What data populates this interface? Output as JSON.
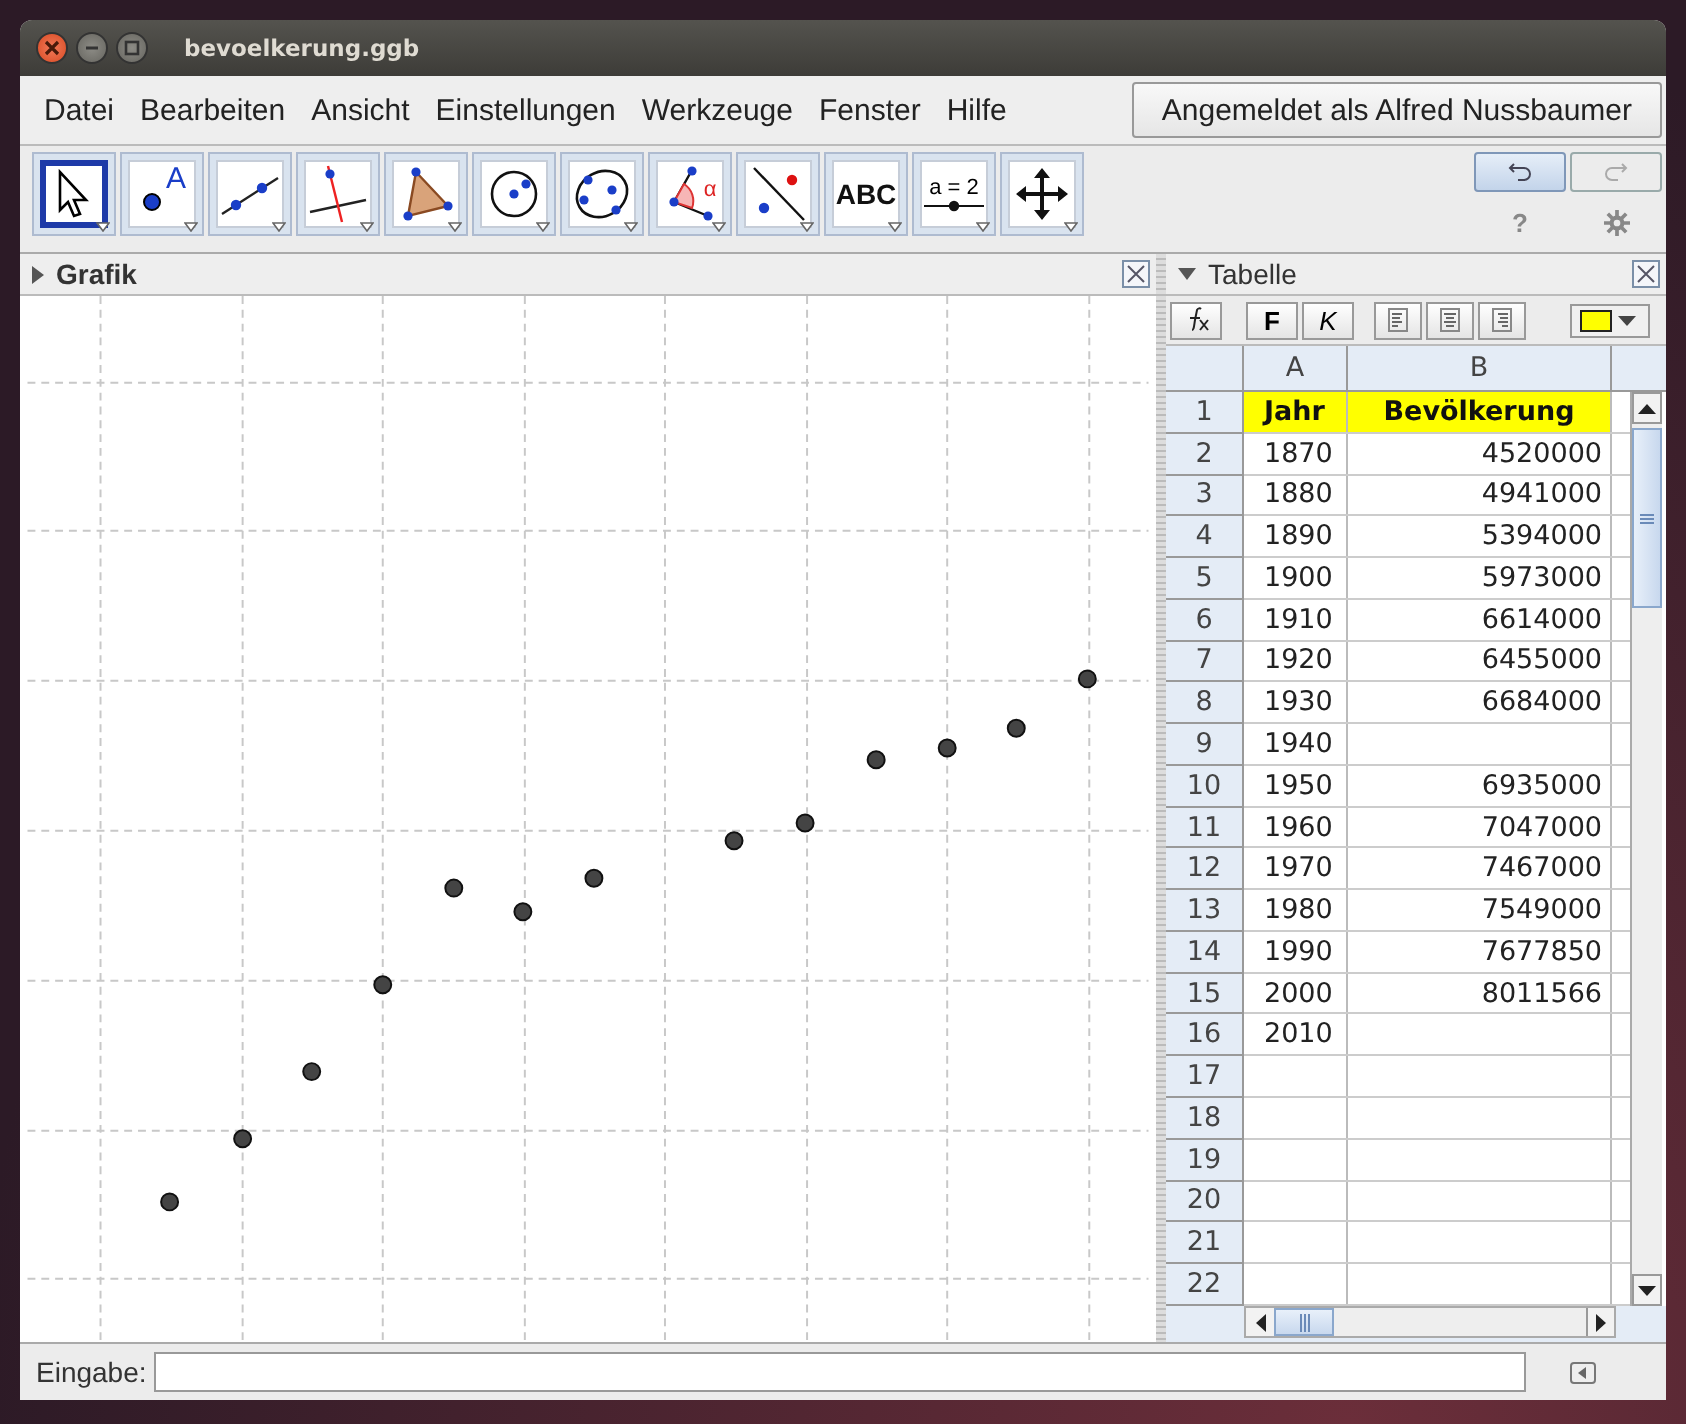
{
  "window": {
    "title": "bevoelkerung.ggb"
  },
  "menu": [
    "Datei",
    "Bearbeiten",
    "Ansicht",
    "Einstellungen",
    "Werkzeuge",
    "Fenster",
    "Hilfe"
  ],
  "login_button": "Angemeldet als Alfred Nussbaumer",
  "tools": [
    {
      "kind": "move",
      "selected": true
    },
    {
      "kind": "point",
      "label": "A",
      "selected": false
    },
    {
      "kind": "line",
      "selected": false
    },
    {
      "kind": "perpendicular",
      "selected": false
    },
    {
      "kind": "polygon",
      "selected": false
    },
    {
      "kind": "circle",
      "selected": false
    },
    {
      "kind": "conic",
      "selected": false
    },
    {
      "kind": "angle",
      "label": "α",
      "selected": false
    },
    {
      "kind": "reflect",
      "selected": false
    },
    {
      "kind": "text",
      "label": "ABC",
      "selected": false
    },
    {
      "kind": "slider",
      "label": "a = 2",
      "selected": false
    },
    {
      "kind": "move-view",
      "selected": false
    }
  ],
  "help": "?",
  "graphics": {
    "title": "Grafik"
  },
  "spreadsheet": {
    "title": "Tabelle",
    "toolbar": {
      "bold": "F",
      "italic": "K"
    },
    "columns": [
      "A",
      "B"
    ],
    "rows": [
      {
        "number": "1",
        "a": "Jahr",
        "b": "Bevölkerung",
        "highlighted": true
      },
      {
        "number": "2",
        "a": "1870",
        "b": "4520000",
        "highlighted": false
      },
      {
        "number": "3",
        "a": "1880",
        "b": "4941000",
        "highlighted": false
      },
      {
        "number": "4",
        "a": "1890",
        "b": "5394000",
        "highlighted": false
      },
      {
        "number": "5",
        "a": "1900",
        "b": "5973000",
        "highlighted": false
      },
      {
        "number": "6",
        "a": "1910",
        "b": "6614000",
        "highlighted": false
      },
      {
        "number": "7",
        "a": "1920",
        "b": "6455000",
        "highlighted": false
      },
      {
        "number": "8",
        "a": "1930",
        "b": "6684000",
        "highlighted": false
      },
      {
        "number": "9",
        "a": "1940",
        "highlighted": false
      },
      {
        "number": "10",
        "a": "1950",
        "b": "6935000",
        "highlighted": false
      },
      {
        "number": "11",
        "a": "1960",
        "b": "7047000",
        "highlighted": false
      },
      {
        "number": "12",
        "a": "1970",
        "b": "7467000",
        "highlighted": false
      },
      {
        "number": "13",
        "a": "1980",
        "b": "7549000",
        "highlighted": false
      },
      {
        "number": "14",
        "a": "1990",
        "b": "7677850",
        "highlighted": false
      },
      {
        "number": "15",
        "a": "2000",
        "b": "8011566",
        "highlighted": false
      },
      {
        "number": "16",
        "a": "2010",
        "highlighted": false
      },
      {
        "number": "17",
        "highlighted": false
      },
      {
        "number": "18",
        "highlighted": false
      },
      {
        "number": "19",
        "highlighted": false
      },
      {
        "number": "20",
        "highlighted": false
      },
      {
        "number": "21",
        "highlighted": false
      },
      {
        "number": "22",
        "highlighted": false
      }
    ]
  },
  "input_bar": {
    "label": "Eingabe:"
  }
}
